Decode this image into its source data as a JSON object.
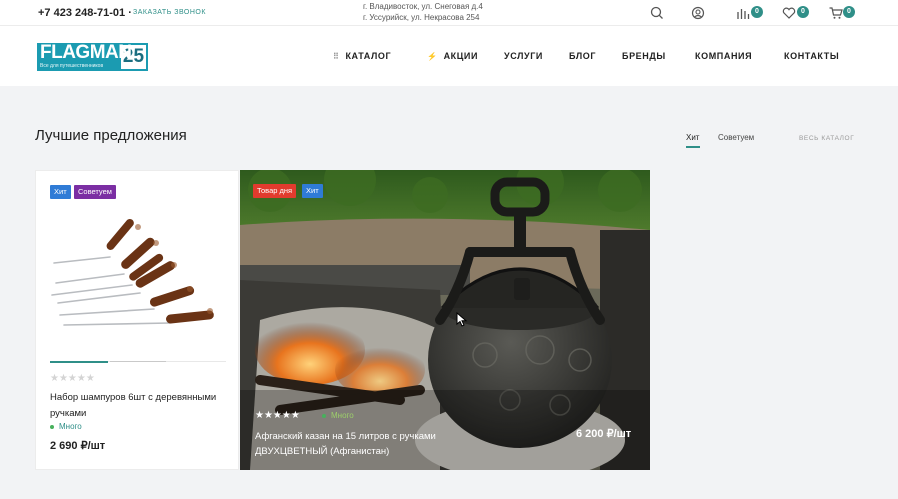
{
  "topbar": {
    "phone": "+7 423 248-71-01 ·",
    "callback": "заказать звонок",
    "address1": "г. Владивосток, ул. Снеговая д.4",
    "address2": "г. Уссурийск, ул. Некрасова 254",
    "compare_count": "0",
    "favorites_count": "0",
    "cart_count": "0",
    "accent": "#2f8f88"
  },
  "logo": {
    "word": "FLAGMAN",
    "number": "25",
    "tagline": "Все для путешественников",
    "color": "#1b9bb1"
  },
  "nav": {
    "catalog": "Каталог",
    "promo": "Акции",
    "services": "Услуги",
    "blog": "Блог",
    "brands": "Бренды",
    "company": "Компания",
    "contacts": "Контакты"
  },
  "section": {
    "title": "Лучшие предложения",
    "tab_hit": "Хит",
    "tab_recommend": "Советуем",
    "all_catalog": "Весь каталог"
  },
  "products": [
    {
      "labels": [
        "Хит",
        "Советуем"
      ],
      "rating_text": "★★★★★",
      "name": "Набор шампуров 6шт с деревянными ручками",
      "stock": "Много",
      "price": "2 690 ₽/шт"
    },
    {
      "labels": [
        "Товар дня",
        "Хит"
      ],
      "rating_text": "★★★★★",
      "name": "Афганский казан на 15 литров с ручками ДВУХЦВЕТНЫЙ (Афганистан)",
      "stock": "Много",
      "price": "6 200 ₽/шт"
    }
  ]
}
